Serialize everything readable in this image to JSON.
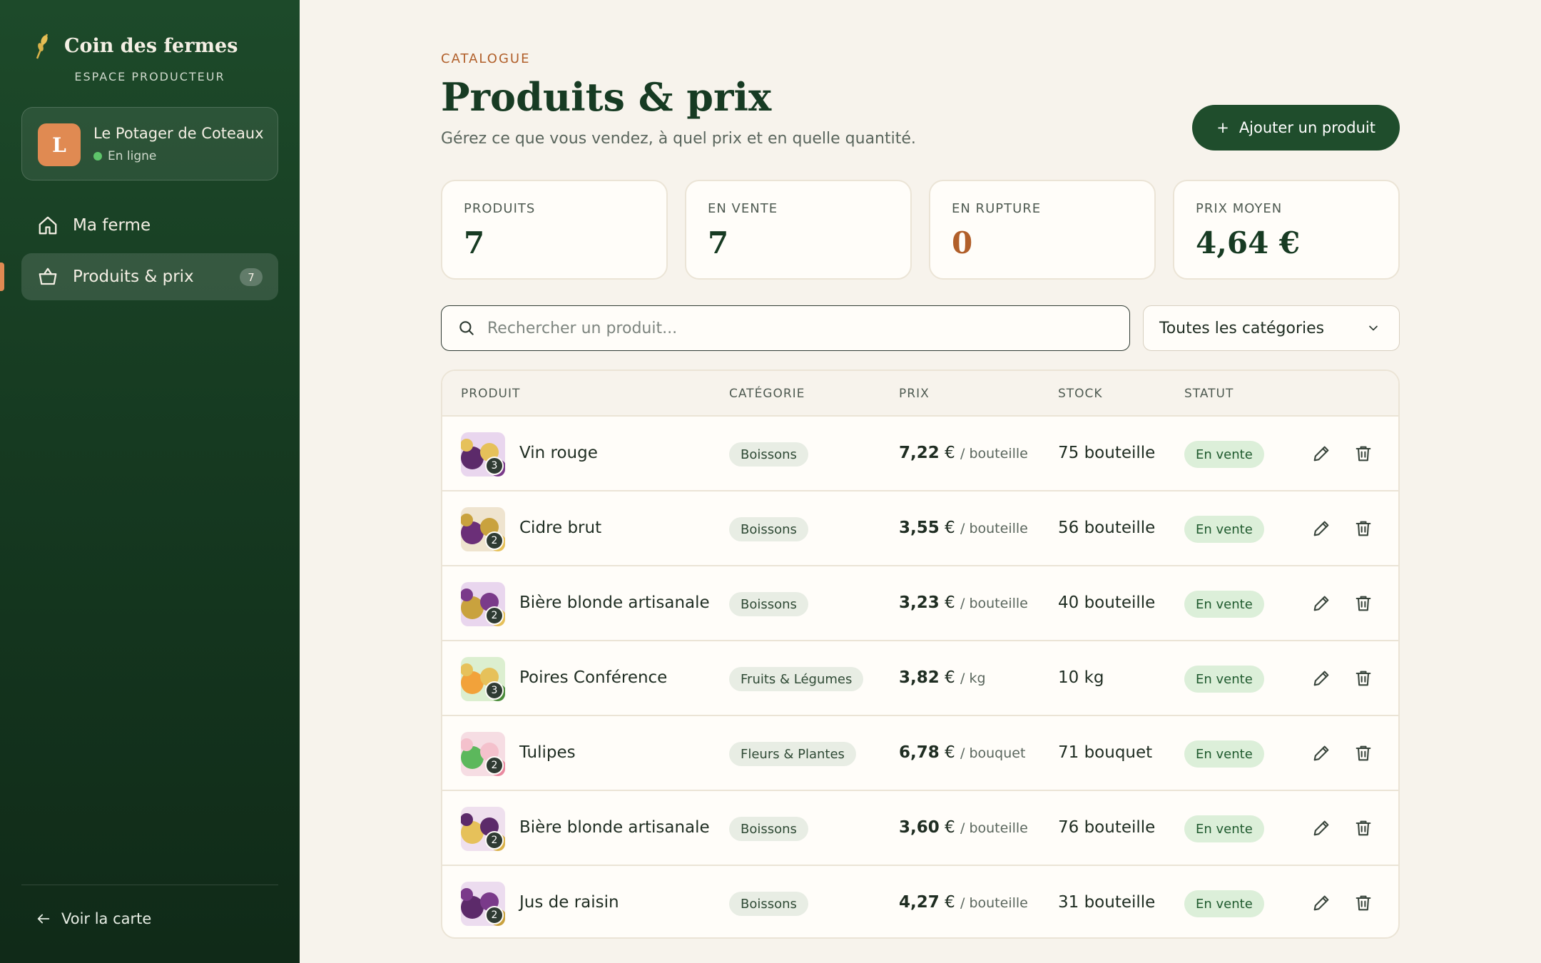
{
  "brand": {
    "title": "Coin des fermes",
    "subtitle": "ESPACE PRODUCTEUR"
  },
  "farm": {
    "initial": "L",
    "name": "Le Potager de Coteaux",
    "status": "En ligne"
  },
  "nav": [
    {
      "label": "Ma ferme",
      "icon": "home-icon"
    },
    {
      "label": "Produits & prix",
      "icon": "basket-icon",
      "count": "7",
      "active": true
    }
  ],
  "footer": {
    "back_label": "Voir la carte"
  },
  "header": {
    "eyebrow": "CATALOGUE",
    "title": "Produits & prix",
    "subtitle": "Gérez ce que vous vendez, à quel prix et en quelle quantité.",
    "add_button": "Ajouter un produit"
  },
  "stats": [
    {
      "label": "PRODUITS",
      "value": "7"
    },
    {
      "label": "EN VENTE",
      "value": "7"
    },
    {
      "label": "EN RUPTURE",
      "value": "0"
    },
    {
      "label": "PRIX MOYEN",
      "value": "4,64 €"
    }
  ],
  "filters": {
    "search_placeholder": "Rechercher un produit...",
    "category_selected": "Toutes les catégories"
  },
  "table": {
    "columns": [
      "PRODUIT",
      "CATÉGORIE",
      "PRIX",
      "STOCK",
      "STATUT"
    ],
    "rows": [
      {
        "name": "Vin rouge",
        "category": "Boissons",
        "price": "7,22",
        "currency": "€",
        "unit": "/ bouteille",
        "stock": "75 bouteille",
        "status": "En vente",
        "photos": "3"
      },
      {
        "name": "Cidre brut",
        "category": "Boissons",
        "price": "3,55",
        "currency": "€",
        "unit": "/ bouteille",
        "stock": "56 bouteille",
        "status": "En vente",
        "photos": "2"
      },
      {
        "name": "Bière blonde artisanale",
        "category": "Boissons",
        "price": "3,23",
        "currency": "€",
        "unit": "/ bouteille",
        "stock": "40 bouteille",
        "status": "En vente",
        "photos": "2"
      },
      {
        "name": "Poires Conférence",
        "category": "Fruits & Légumes",
        "price": "3,82",
        "currency": "€",
        "unit": "/ kg",
        "stock": "10 kg",
        "status": "En vente",
        "photos": "3"
      },
      {
        "name": "Tulipes",
        "category": "Fleurs & Plantes",
        "price": "6,78",
        "currency": "€",
        "unit": "/ bouquet",
        "stock": "71 bouquet",
        "status": "En vente",
        "photos": "2"
      },
      {
        "name": "Bière blonde artisanale",
        "category": "Boissons",
        "price": "3,60",
        "currency": "€",
        "unit": "/ bouteille",
        "stock": "76 bouteille",
        "status": "En vente",
        "photos": "2"
      },
      {
        "name": "Jus de raisin",
        "category": "Boissons",
        "price": "4,27",
        "currency": "€",
        "unit": "/ bouteille",
        "stock": "31 bouteille",
        "status": "En vente",
        "photos": "2"
      }
    ]
  },
  "colors": {
    "primary": "#1f4d2c",
    "accent": "#e08a52",
    "warning": "#b15f2a",
    "background": "#f7f3ec"
  }
}
